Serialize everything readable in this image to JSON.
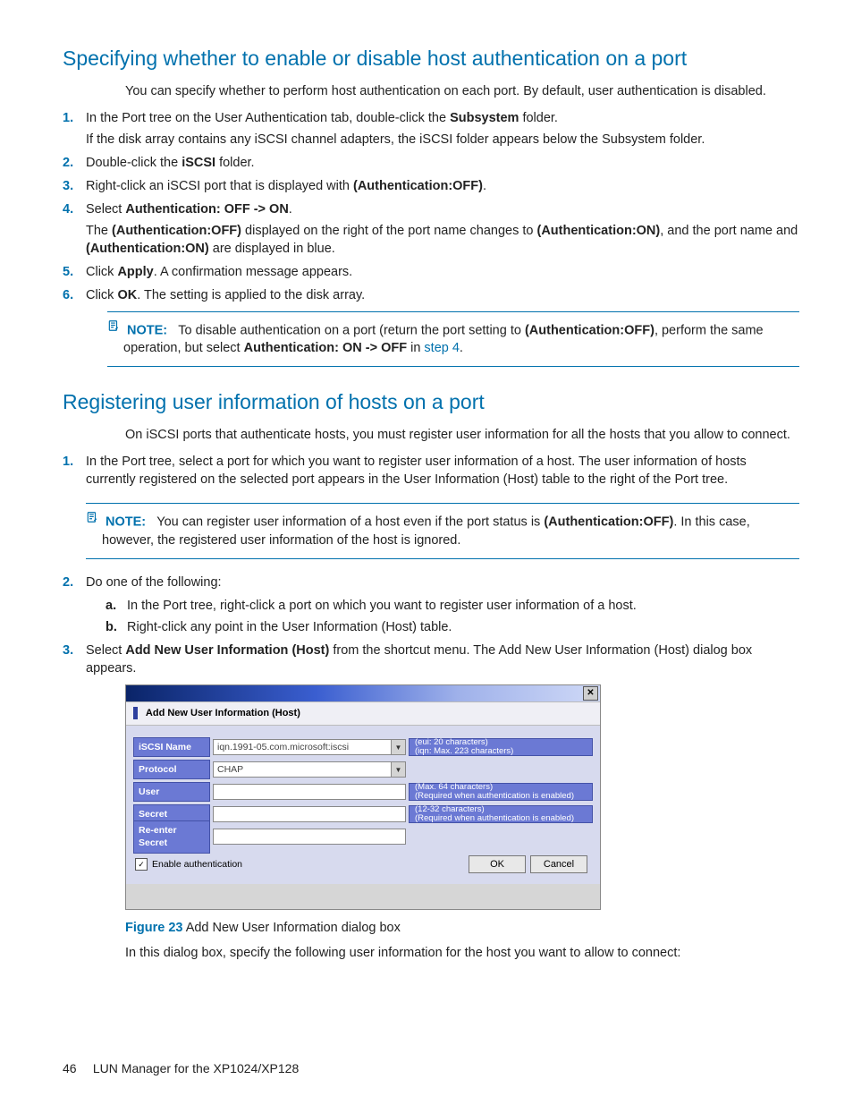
{
  "h1": "Specifying whether to enable or disable host authentication on a port",
  "p1": "You can specify whether to perform host authentication on each port. By default, user authentication is disabled.",
  "s1": {
    "li1_a": "In the Port tree on the User Authentication tab, double-click the ",
    "li1_b": "Subsystem",
    "li1_c": " folder.",
    "li1_note": "If the disk array contains any iSCSI channel adapters, the iSCSI folder appears below the Subsystem folder.",
    "li2_a": "Double-click the ",
    "li2_b": "iSCSI",
    "li2_c": " folder.",
    "li3_a": "Right-click an iSCSI port that is displayed with ",
    "li3_b": "(Authentication:OFF)",
    "li3_c": ".",
    "li4_a": "Select ",
    "li4_b": "Authentication: OFF -> ON",
    "li4_c": ".",
    "li4_d_a": "The ",
    "li4_d_b": "(Authentication:OFF)",
    "li4_d_c": " displayed on the right of the port name changes to ",
    "li4_d_d": "(Authentication:ON)",
    "li4_d_e": ", and the port name and ",
    "li4_d_f": "(Authentication:ON)",
    "li4_d_g": " are displayed in blue.",
    "li5_a": "Click ",
    "li5_b": "Apply",
    "li5_c": ". A confirmation message appears.",
    "li6_a": "Click ",
    "li6_b": "OK",
    "li6_c": ". The setting is applied to the disk array."
  },
  "note1": {
    "label": "NOTE:",
    "a": "To disable authentication on a port (return the port setting to ",
    "b": "(Authentication:OFF)",
    "c": ", perform the same operation, but select ",
    "d": "Authentication: ON -> OFF",
    "e": " in ",
    "link": "step 4",
    "f": "."
  },
  "h2": "Registering user information of hosts on a port",
  "p2": "On iSCSI ports that authenticate hosts, you must register user information for all the hosts that you allow to connect.",
  "s2": {
    "li1": "In the Port tree, select a port for which you want to register user information of a host. The user information of hosts currently registered on the selected port appears in the User Information (Host) table to the right of the Port tree.",
    "li2": "Do one of the following:",
    "li2a": "In the Port tree, right-click a port on which you want to register user information of a host.",
    "li2b": "Right-click any point in the User Information (Host) table.",
    "li3_a": "Select ",
    "li3_b": "Add New User Information (Host)",
    "li3_c": " from the shortcut menu. The Add New User Information (Host) dialog box appears."
  },
  "note2": {
    "label": "NOTE:",
    "a": "You can register user information of a host even if the port status is ",
    "b": "(Authentication:OFF)",
    "c": ". In this case, however, the registered user information of the host is ignored."
  },
  "dialog": {
    "title": "Add New User Information (Host)",
    "rows": {
      "iscsi": {
        "label": "iSCSI Name",
        "value": "iqn.1991-05.com.microsoft:iscsi",
        "hint1": "(eui: 20 characters)",
        "hint2": "(iqn: Max. 223 characters)"
      },
      "protocol": {
        "label": "Protocol",
        "value": "CHAP"
      },
      "user": {
        "label": "User",
        "hint1": "(Max. 64 characters)",
        "hint2": "(Required when authentication is enabled)"
      },
      "secret": {
        "label": "Secret",
        "hint1": "(12-32 characters)",
        "hint2": "(Required when authentication is enabled)"
      },
      "resecret": {
        "label": "Re-enter Secret"
      }
    },
    "enable": "Enable authentication",
    "ok": "OK",
    "cancel": "Cancel"
  },
  "fig": {
    "label": "Figure 23",
    "caption": " Add New User Information dialog box"
  },
  "p3": "In this dialog box, specify the following user information for the host you want to allow to connect:",
  "footer": {
    "page": "46",
    "doc": "LUN Manager for the XP1024/XP128"
  }
}
